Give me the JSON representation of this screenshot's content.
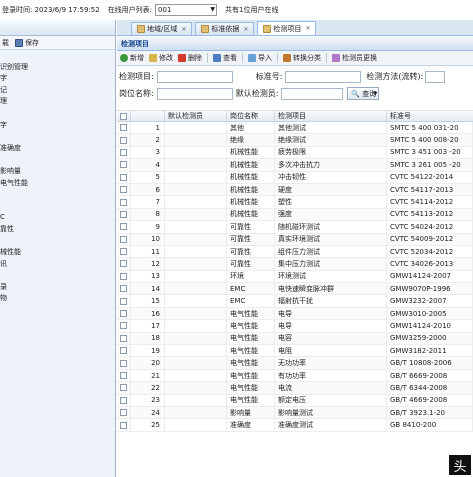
{
  "topbar": {
    "login_time_label": "登录时间: 2023/6/9 17:59:52",
    "online_users_label": "在线用户列表:",
    "online_users_value": "001",
    "online_count_text": "共有1位用户在线"
  },
  "sidebar": {
    "toolbar_left": "载",
    "save_label": "保存",
    "items": [
      "",
      "识别管理",
      "字",
      "记",
      "理",
      "",
      "字",
      "",
      "准确度",
      "",
      "影响量",
      "电气性能",
      "",
      "",
      "C",
      "靠性",
      "",
      "械性能",
      "讯",
      "",
      "录",
      "物",
      "",
      "",
      "",
      "",
      "",
      "",
      "",
      "",
      "",
      "",
      "",
      ""
    ]
  },
  "tabs": [
    {
      "label": "地域/区域",
      "active": false
    },
    {
      "label": "标准依据",
      "active": false
    },
    {
      "label": "检测项目",
      "active": true
    }
  ],
  "panel": {
    "title": "检测项目",
    "toolbar": [
      "新增",
      "修改",
      "删除",
      "查看",
      "导入",
      "转换分类",
      "检测员更换"
    ],
    "form": {
      "item_label": "检测项目:",
      "std_label": "标准号:",
      "method_label": "检测方法(流转):",
      "post_label": "岗位名称:",
      "inspector_label": "默认检测员:",
      "search_label": "查询"
    }
  },
  "grid": {
    "headers": [
      "",
      "",
      "默认检测员",
      "岗位名称",
      "检测项目",
      "标准号"
    ],
    "rows": [
      {
        "n": "1",
        "post": "其他",
        "item": "其他测试",
        "std": "SMTC 5 400 031-20"
      },
      {
        "n": "2",
        "post": "绝缘",
        "item": "绝缘测试",
        "std": "SMTC 5 400 008-20"
      },
      {
        "n": "3",
        "post": "机械性能",
        "item": "疲劳极限",
        "std": "SMTC 3 451 003 -20"
      },
      {
        "n": "4",
        "post": "机械性能",
        "item": "多次冲击抗力",
        "std": "SMTC 3 261 005 -20"
      },
      {
        "n": "5",
        "post": "机械性能",
        "item": "冲击韧性",
        "std": "CVTC 54122-2014"
      },
      {
        "n": "6",
        "post": "机械性能",
        "item": "硬度",
        "std": "CVTC 54117-2013"
      },
      {
        "n": "7",
        "post": "机械性能",
        "item": "塑性",
        "std": "CVTC 54114-2012"
      },
      {
        "n": "8",
        "post": "机械性能",
        "item": "强度",
        "std": "CVTC 54113-2012"
      },
      {
        "n": "9",
        "post": "可靠性",
        "item": "随机碰环测试",
        "std": "CVTC 54024-2012"
      },
      {
        "n": "10",
        "post": "可靠性",
        "item": "真实环境测试",
        "std": "CVTC 54009-2012"
      },
      {
        "n": "11",
        "post": "可靠性",
        "item": "组件压力测试",
        "std": "CVTC 52034-2012"
      },
      {
        "n": "12",
        "post": "可靠性",
        "item": "集中压力测试",
        "std": "CVTC 34026-2013"
      },
      {
        "n": "13",
        "post": "环境",
        "item": "环境测试",
        "std": "GMW14124-2007"
      },
      {
        "n": "14",
        "post": "EMC",
        "item": "电快速瞬变脉冲群",
        "std": "GMW9070P-1996"
      },
      {
        "n": "15",
        "post": "EMC",
        "item": "辐射抗干扰",
        "std": "GMW3232-2007"
      },
      {
        "n": "16",
        "post": "电气性能",
        "item": "电导",
        "std": "GMW3010-2005"
      },
      {
        "n": "17",
        "post": "电气性能",
        "item": "电导",
        "std": "GMW14124-2010"
      },
      {
        "n": "18",
        "post": "电气性能",
        "item": "电容",
        "std": "GMW3259-2000"
      },
      {
        "n": "19",
        "post": "电气性能",
        "item": "电阻",
        "std": "GMW3182-2011"
      },
      {
        "n": "20",
        "post": "电气性能",
        "item": "无功功率",
        "std": "GB/T 10808-2006"
      },
      {
        "n": "21",
        "post": "电气性能",
        "item": "有功功率",
        "std": "GB/T 6669-2008"
      },
      {
        "n": "22",
        "post": "电气性能",
        "item": "电流",
        "std": "GB/T 6344-2008"
      },
      {
        "n": "23",
        "post": "电气性能",
        "item": "额定电压",
        "std": "GB/T 4669-2008"
      },
      {
        "n": "24",
        "post": "影响量",
        "item": "影响量测试",
        "std": "GB/T 3923.1-20"
      },
      {
        "n": "25",
        "post": "准确度",
        "item": "准确度测试",
        "std": "GB 8410-200"
      }
    ]
  },
  "watermark": "头"
}
